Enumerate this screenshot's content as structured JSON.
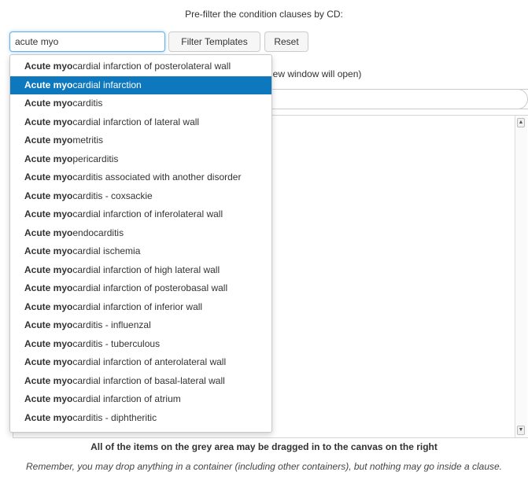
{
  "prefilter_label": "Pre-filter the condition clauses by CD:",
  "search": {
    "value": "acute myo"
  },
  "buttons": {
    "filter": "Filter Templates",
    "reset": "Reset"
  },
  "hint_text": "new window will open)",
  "dropdown": {
    "match_prefix": "Acute myo",
    "selected_index": 1,
    "items": [
      "cardial infarction of posterolateral wall",
      "cardial infarction",
      "carditis",
      "cardial infarction of lateral wall",
      "metritis",
      "pericarditis",
      "carditis associated with another disorder",
      "carditis - coxsackie",
      "cardial infarction of inferolateral wall",
      "endocarditis",
      "cardial ischemia",
      "cardial infarction of high lateral wall",
      "cardial infarction of posterobasal wall",
      "cardial infarction of inferior wall",
      "carditis - influenzal",
      "carditis - tuberculous",
      "cardial infarction of anterolateral wall",
      "cardial infarction of basal-lateral wall",
      "cardial infarction of atrium",
      "carditis - diphtheritic"
    ]
  },
  "drag_note": "All of the items on the grey area may be dragged in to the canvas on the right",
  "remember_note": "Remember, you may drop anything in a container (including other containers), but nothing may go inside a clause.",
  "icons": {
    "scroll_up": "scroll-up-arrow-icon",
    "scroll_down": "scroll-down-arrow-icon"
  },
  "colors": {
    "selected": "#0e78be",
    "focus_border": "#66afe9"
  }
}
